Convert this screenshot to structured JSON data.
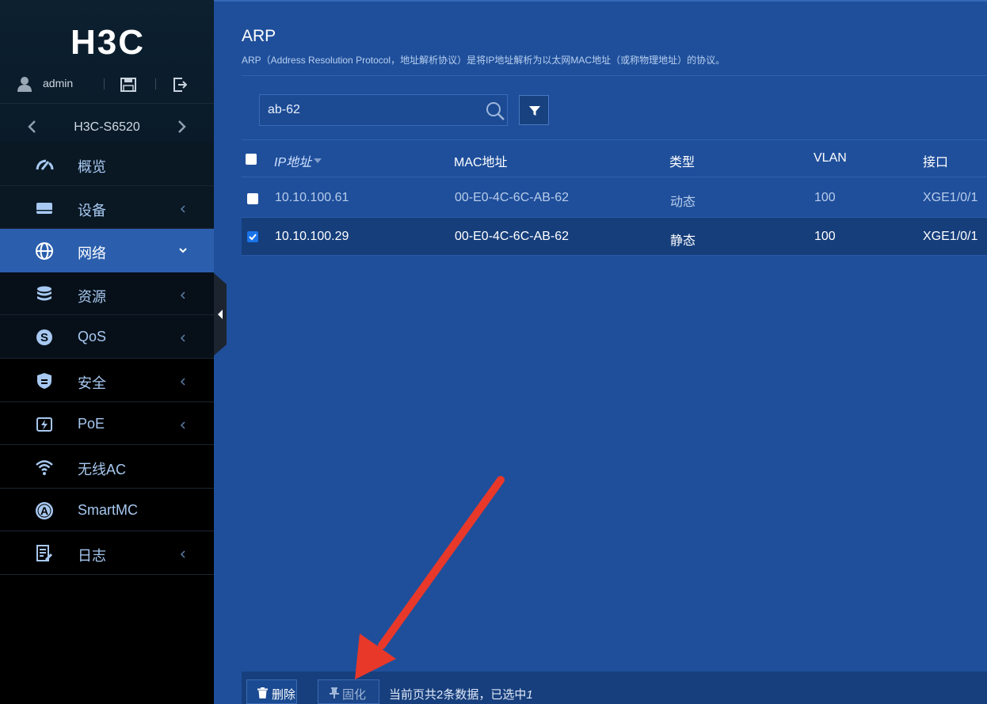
{
  "brand": {
    "logo_text": "H3C"
  },
  "user": {
    "name": "admin"
  },
  "device": {
    "name": "H3C-S6520"
  },
  "menu": [
    {
      "label": "概览",
      "icon": "dashboard-icon",
      "has_arrow": false
    },
    {
      "label": "设备",
      "icon": "device-icon",
      "has_arrow": true
    },
    {
      "label": "网络",
      "icon": "globe-icon",
      "has_arrow": true,
      "active": true
    },
    {
      "label": "资源",
      "icon": "database-icon",
      "has_arrow": true
    },
    {
      "label": "QoS",
      "icon": "qos-icon",
      "has_arrow": true
    },
    {
      "label": "安全",
      "icon": "shield-icon",
      "has_arrow": true
    },
    {
      "label": "PoE",
      "icon": "poe-icon",
      "has_arrow": true
    },
    {
      "label": "无线AC",
      "icon": "wifi-icon",
      "has_arrow": false
    },
    {
      "label": "SmartMC",
      "icon": "smartmc-icon",
      "has_arrow": false
    },
    {
      "label": "日志",
      "icon": "log-icon",
      "has_arrow": true
    }
  ],
  "page": {
    "title": "ARP",
    "description": "ARP（Address Resolution Protocol，地址解析协议）是将IP地址解析为以太网MAC地址（或称物理地址）的协议。"
  },
  "search": {
    "value": "ab-62"
  },
  "table": {
    "headers": [
      "IP地址",
      "MAC地址",
      "类型",
      "VLAN",
      "接口"
    ],
    "rows": [
      {
        "ip": "10.10.100.61",
        "mac": "00-E0-4C-6C-AB-62",
        "type": "动态",
        "vlan": "100",
        "iface": "XGE1/0/1",
        "checked": false
      },
      {
        "ip": "10.10.100.29",
        "mac": "00-E0-4C-6C-AB-62",
        "type": "静态",
        "vlan": "100",
        "iface": "XGE1/0/1",
        "checked": true
      }
    ]
  },
  "footer": {
    "delete_label": "删除",
    "pin_label": "固化",
    "status_prefix": "当前页共2条数据，已选中",
    "selected_count": "1"
  },
  "colors": {
    "accent": "#2b5fae",
    "annotation_arrow": "#e8382a"
  }
}
